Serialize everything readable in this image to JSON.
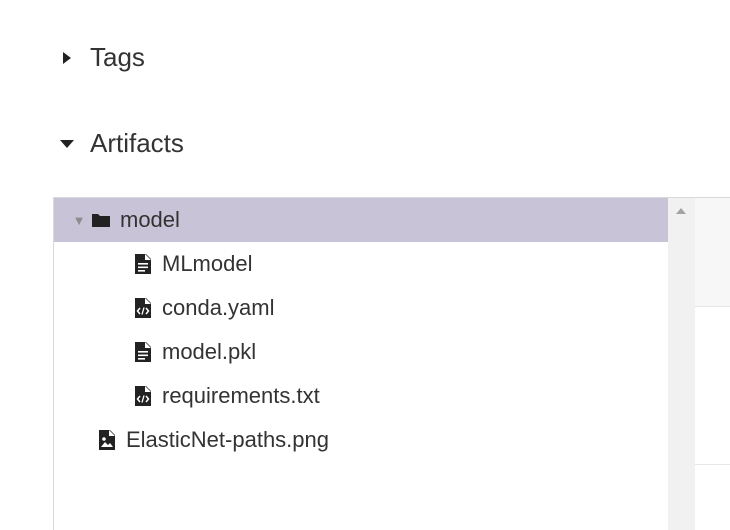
{
  "sections": {
    "tags": {
      "label": "Tags",
      "expanded": false
    },
    "artifacts": {
      "label": "Artifacts",
      "expanded": true
    }
  },
  "artifacts_tree": {
    "items": [
      {
        "label": "model",
        "kind": "folder",
        "icon": "folder-icon",
        "expanded": true,
        "selected": true
      },
      {
        "label": "MLmodel",
        "kind": "file",
        "icon": "file-text-icon"
      },
      {
        "label": "conda.yaml",
        "kind": "file",
        "icon": "file-code-icon"
      },
      {
        "label": "model.pkl",
        "kind": "file",
        "icon": "file-text-icon"
      },
      {
        "label": "requirements.txt",
        "kind": "file",
        "icon": "file-code-icon"
      },
      {
        "label": "ElasticNet-paths.png",
        "kind": "file",
        "icon": "file-image-icon"
      }
    ]
  },
  "colors": {
    "selected_row": "#c8c3d6",
    "text": "#333333"
  }
}
